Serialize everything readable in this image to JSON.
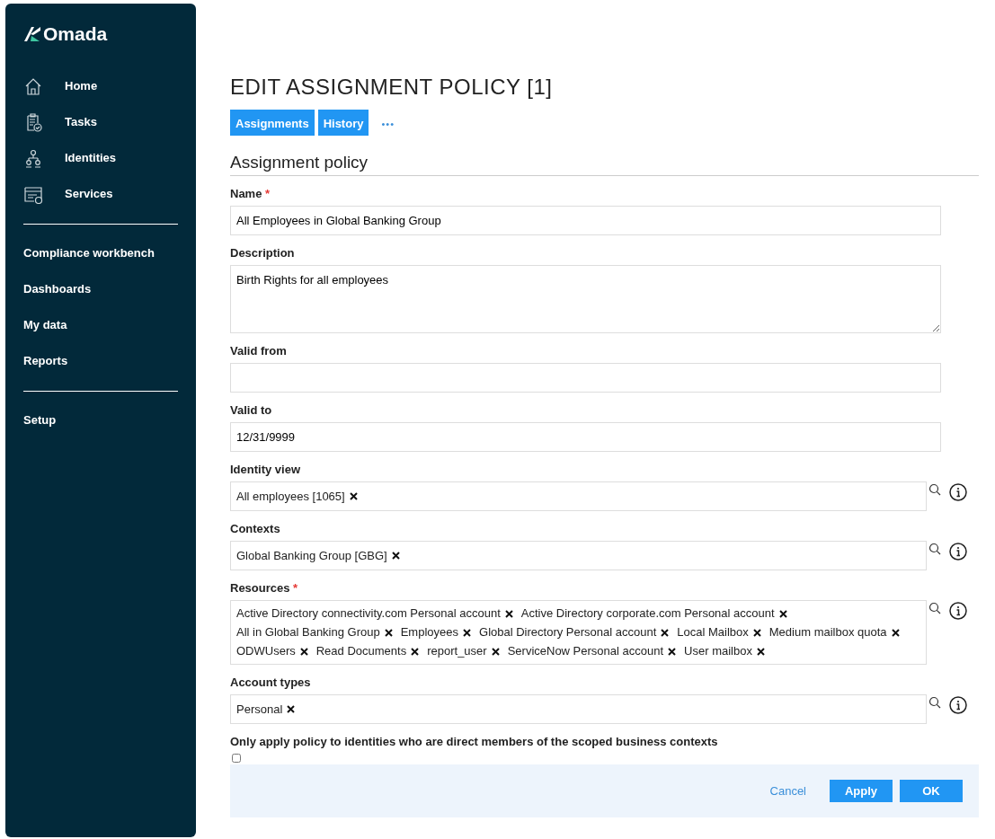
{
  "sidebar": {
    "logo": "Omada",
    "groups": [
      [
        {
          "label": "Home"
        },
        {
          "label": "Tasks"
        },
        {
          "label": "Identities"
        },
        {
          "label": "Services"
        }
      ],
      [
        {
          "label": "Compliance workbench"
        },
        {
          "label": "Dashboards"
        },
        {
          "label": "My data"
        },
        {
          "label": "Reports"
        }
      ],
      [
        {
          "label": "Setup"
        }
      ]
    ]
  },
  "page": {
    "title": "EDIT ASSIGNMENT POLICY [1]",
    "tabs": [
      "Assignments",
      "History"
    ],
    "more": "•••",
    "section": "Assignment policy",
    "fields": [
      {
        "kind": "text",
        "label": "Name",
        "required_mark": "*",
        "value": "All Employees in Global Banking Group"
      },
      {
        "kind": "textarea",
        "label": "Description",
        "value": "Birth Rights for all employees"
      },
      {
        "kind": "text",
        "label": "Valid from"
      },
      {
        "kind": "text",
        "label": "Valid to",
        "value": "12/31/9999"
      },
      {
        "kind": "tags",
        "label": "Identity view",
        "tags": [
          "All employees [1065]"
        ]
      },
      {
        "kind": "tags",
        "label": "Contexts",
        "tags": [
          "Global Banking Group [GBG]"
        ]
      },
      {
        "kind": "tags",
        "label": "Resources",
        "required_mark": "*",
        "tags": [
          "Active Directory connectivity.com Personal account",
          "Active Directory corporate.com Personal account",
          "All in Global Banking Group",
          "Employees",
          "Global Directory Personal account",
          "Local Mailbox",
          "Medium mailbox quota",
          "ODWUsers",
          "Read Documents",
          "report_user",
          "ServiceNow Personal account",
          "User mailbox"
        ]
      },
      {
        "kind": "tags",
        "label": "Account types",
        "tags": [
          "Personal"
        ]
      }
    ],
    "checkbox": {
      "label": "Only apply policy to identities who are direct members of the scoped business contexts",
      "checked": false
    },
    "buttons": [
      {
        "kind": "link",
        "label": "Cancel"
      },
      {
        "kind": "primary",
        "label": "Apply"
      },
      {
        "kind": "primary",
        "label": "OK"
      }
    ]
  }
}
